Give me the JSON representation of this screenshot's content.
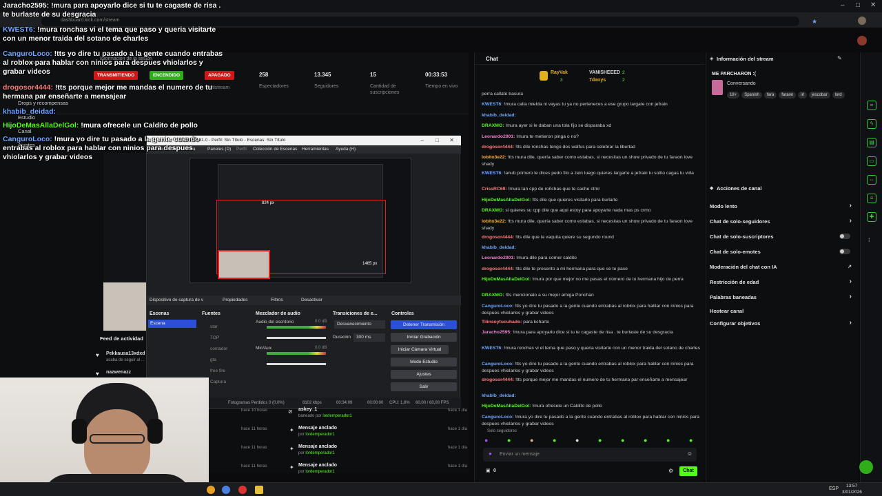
{
  "browser": {
    "url": "dashboard.kick.com/stream"
  },
  "dashboard": {
    "stream_info_label": "Información de la sesión",
    "badges": [
      {
        "label": "TRANSMITIENDO",
        "color": "#d11717"
      },
      {
        "label": "ENCENDIDO",
        "color": "#2fae1a"
      },
      {
        "label": "APAGADO",
        "color": "#d11717"
      }
    ],
    "restream_label": "Multistream",
    "stats": [
      {
        "value": "258",
        "label": "Espectadores"
      },
      {
        "value": "13.345",
        "label": "Seguidores"
      },
      {
        "value": "15",
        "label": "Cantidad de suscripciones"
      },
      {
        "value": "00:33:53",
        "label": "Tiempo en vivo"
      }
    ],
    "left_menu": [
      "Stream",
      "Drops y recompensas",
      "Estudio",
      "Canal",
      "Ajustes"
    ]
  },
  "overlay_chat": [
    {
      "user": "Jaracho2595:",
      "user_color": "#ffffff",
      "text": "!mura para apoyarlo dice si tu te cagaste de risa . te burlaste de su desgracia"
    },
    {
      "user": "KWEST6:",
      "user_color": "#6fa8ff",
      "text": "!mura ronchas vi el tema que paso y queria visitarte con un menor traida del sotano de charles"
    },
    {
      "user": "CanguroLoco:",
      "user_color": "#6fa8ff",
      "text": "!tts yo dire tu pasado a la gente cuando entrabas al roblox para hablar con ninios para despues vhiolarlos y grabar videos"
    },
    {
      "user": "drogosor4444:",
      "user_color": "#ff7b7b",
      "text": "!tts porque mejor me mandas el numero de tu hermana par enseñarte a mensajear"
    },
    {
      "user": "khabib_deidad:",
      "user_color": "#6fa8ff",
      "text": ""
    },
    {
      "user": "HijoDeMasAllaDelGol:",
      "user_color": "#53fc18",
      "text": "!mura ofrecele un Caldito de pollo"
    },
    {
      "user": "CanguroLoco:",
      "user_color": "#6fa8ff",
      "text": "!mura yo dire tu pasado a la gente cuando entrabas al roblox para hablar con ninios para despues vhiolarlos y grabar videos"
    }
  ],
  "obs": {
    "title": "OBS 31.0 - Perfil: Sin Título - Escenas: Sin Título",
    "menu": [
      "Archivo",
      "Editar",
      "Vista",
      "Paneles (D)",
      "Perfil",
      "Colección de Escenas",
      "Herramientas",
      "Ayuda (H)"
    ],
    "preview_dims_a": "824 px",
    "preview_dims_b": "1465 px",
    "source_bar": {
      "device": "Dispositivo de captura de v",
      "props": "Propiedades",
      "filters": "Filtros",
      "deactivate": "Desactivar"
    },
    "docks": {
      "scenes": "Escenas",
      "sources": "Fuentes",
      "mixer": "Mezclador de audio",
      "transitions": "Transiciones de e...",
      "controls": "Controles"
    },
    "scene_item": "Escena",
    "sources": [
      "star",
      "TOP",
      "contador",
      "gta",
      "free fire",
      "Captura"
    ],
    "mixer": [
      {
        "name": "Audio del escritorio",
        "db": "0.0 dB"
      },
      {
        "name": "Mic/Aux",
        "db": "0.0 dB"
      }
    ],
    "transition": "Desvanecimiento",
    "duration_label": "Duración",
    "duration_value": "300 ms",
    "controls": [
      "Detener Transmisión",
      "Iniciar Grabación",
      "Iniciar Cámara Virtual",
      "Modo Estudio",
      "Ajustes",
      "Salir"
    ],
    "status": {
      "dropped": "Fotogramas Perdidos 0 (0,0%)",
      "kbps": "8102 kbps",
      "time1": "00:34:09",
      "time2": "00:00:00",
      "cpu": "CPU: 1,8%",
      "fps": "60,00 / 60,00 FPS"
    }
  },
  "activity": {
    "title": "Feed de actividad",
    "items": [
      {
        "name": "Pekkausa13xdxd",
        "sub": "acaba de seguir al ..."
      },
      {
        "name": "nazwenazz",
        "sub": ""
      }
    ],
    "times": [
      "hace 10 horas",
      "hace 11 horas",
      "hace 11 horas",
      "hace 11 horas"
    ]
  },
  "modlog": [
    {
      "title": "askey_1",
      "sub_prefix": "baneado por",
      "by": "lordemperador1",
      "time": "hace 1 día"
    },
    {
      "title": "Mensaje anclado",
      "sub_prefix": "por",
      "by": "lordemperador1",
      "time": "hace 1 día"
    },
    {
      "title": "Mensaje anclado",
      "sub_prefix": "por",
      "by": "lordemperador1",
      "time": "hace 1 día"
    },
    {
      "title": "Mensaje anclado",
      "sub_prefix": "por",
      "by": "lordemperador1",
      "time": "hace 1 día"
    }
  ],
  "chat": {
    "title": "Chat",
    "leaders": [
      {
        "name": "RayVak",
        "count": "3"
      },
      {
        "name": "VANISHEEED",
        "count": "2"
      },
      {
        "name": "7danys",
        "count": "2"
      }
    ],
    "messages": [
      {
        "user": "",
        "color": "#cfcfcf",
        "text": "perra callate basura"
      },
      {
        "user": "KWEST6:",
        "color": "#6fa8ff",
        "text": "!mura calla mielda ni vayas tu ya no perteneces a ese grupo largate con jefrain"
      },
      {
        "user": "khabib_deidad:",
        "color": "#6fa8ff",
        "text": ""
      },
      {
        "user": "DRAXMO:",
        "color": "#53fc18",
        "text": "!mura ayer si le daban una tola fijo se disparaba xd"
      },
      {
        "user": "Leonardo2001:",
        "color": "#ff7bd0",
        "text": "!mura te metieron pinga o no?"
      },
      {
        "user": "drogosor4444:",
        "color": "#ff7b7b",
        "text": "!tts dile ronchas tengo dos walfus para celebrar la libertad"
      },
      {
        "user": "lobito3e22:",
        "color": "#ffb347",
        "text": "!tts mura dile, quería saber como estabas, si necesitas un show privado de tu faraon love shady"
      },
      {
        "user": "KWEST6:",
        "color": "#6fa8ff",
        "text": "!anub primero le dices pedo filo a zein luego quieres largarte a jefrain tu solito cagas tu vida"
      },
      {
        "user": "CrissRC69:",
        "color": "#ff7b7b",
        "text": "!mura tan cpp de roñchas que te cache ctmr"
      },
      {
        "user": "HijoDeMasAllaDelGol:",
        "color": "#53fc18",
        "text": "!tts dile que quieres visitarlo para burlarte"
      },
      {
        "user": "DRAXMO:",
        "color": "#53fc18",
        "text": "si quieres su cpp dile que aqui estoy para apoyarte nada mas ps crmo"
      },
      {
        "user": "lobito3e22:",
        "color": "#ffb347",
        "text": "!tts mura dile, quería saber como estabas, si necesitas un show privado de tu faraon love shady"
      },
      {
        "user": "drogosor4444:",
        "color": "#ff7b7b",
        "text": "!tts dile que la vaquita quiere su segundo round"
      },
      {
        "user": "khabib_deidad:",
        "color": "#6fa8ff",
        "text": ""
      },
      {
        "user": "Leonardo2001:",
        "color": "#ff7bd0",
        "text": "!mura dile para comer caldito"
      },
      {
        "user": "drogosor4444:",
        "color": "#ff7b7b",
        "text": "!tts dile te presento a mi hermana para que se te pase"
      },
      {
        "user": "HijoDeMasAllaDelGol:",
        "color": "#53fc18",
        "text": "!mura por que mejor no me pasas el número de tu hermana hijo de perra"
      },
      {
        "user": "DRAXMO:",
        "color": "#53fc18",
        "text": "!tts mencionalo a su mejor amiga Ponchan"
      },
      {
        "user": "CanguroLoco:",
        "color": "#6fa8ff",
        "text": "!tts yo dire tu pasado a la gente cuando entrabas al roblox para hablar con ninios para despues vhiolarlos y grabar videos"
      },
      {
        "user": "Tilinsoytucuhado:",
        "color": "#ff7b7b",
        "text": "para kcharte"
      },
      {
        "user": "Jaracho2595:",
        "color": "#ff7bd0",
        "text": "!mura para apoyarlo dice si tu te cagaste de risa . te burlaste de su desgracia"
      },
      {
        "user": "KWEST6:",
        "color": "#6fa8ff",
        "text": "!mura ronchas vi el tema que paso y queria visitarte con un menor traida del sotano de charles"
      },
      {
        "user": "CanguroLoco:",
        "color": "#6fa8ff",
        "text": "!tts yo dire tu pasado a la gente cuando entrabas al roblox para hablar con ninios para despues vhiolarlos y grabar videos"
      },
      {
        "user": "drogosor4444:",
        "color": "#ff7b7b",
        "text": "!tts porque mejor me mandas el numero de tu hermana par enseñarte a mensajear"
      },
      {
        "user": "khabib_deidad:",
        "color": "#6fa8ff",
        "text": ""
      },
      {
        "user": "HijoDeMasAllaDelGol:",
        "color": "#53fc18",
        "text": "!mura ofrecele un Caldito de pollo"
      },
      {
        "user": "CanguroLoco:",
        "color": "#6fa8ff",
        "text": "!mura yo dire tu pasado a la gente cuando entrabas al roblox para hablar con ninios para despues vhiolarlos y grabar videos"
      }
    ],
    "followers_only": "Solo seguidores",
    "input_placeholder": "Enviar un mensaje",
    "points": "0",
    "send_label": "Chat"
  },
  "stream_info": {
    "title": "Información del stream",
    "stream_title": "ME PARCHARON :(",
    "category": "Conversando",
    "tags": [
      "18+",
      "Spanish",
      "fara",
      "faraon",
      "irl",
      "jescobar",
      "lord"
    ]
  },
  "channel_actions": {
    "title": "Acciones de canal",
    "items": [
      {
        "label": "Modo lento",
        "kind": "chevron"
      },
      {
        "label": "Chat de solo-seguidores",
        "kind": "chevron"
      },
      {
        "label": "Chat de solo-suscriptores",
        "kind": "toggle"
      },
      {
        "label": "Chat de solo-emotes",
        "kind": "toggle"
      },
      {
        "label": "Moderación del chat con IA",
        "kind": "link"
      },
      {
        "label": "Restricción de edad",
        "kind": "chevron"
      },
      {
        "label": "Palabras baneadas",
        "kind": "chevron"
      },
      {
        "label": "Hostear canal",
        "kind": "none"
      },
      {
        "label": "Configurar objetivos",
        "kind": "chevron"
      }
    ]
  },
  "taskbar": {
    "lang": "ESP",
    "time": "13:57",
    "date": "3/01/2026"
  }
}
